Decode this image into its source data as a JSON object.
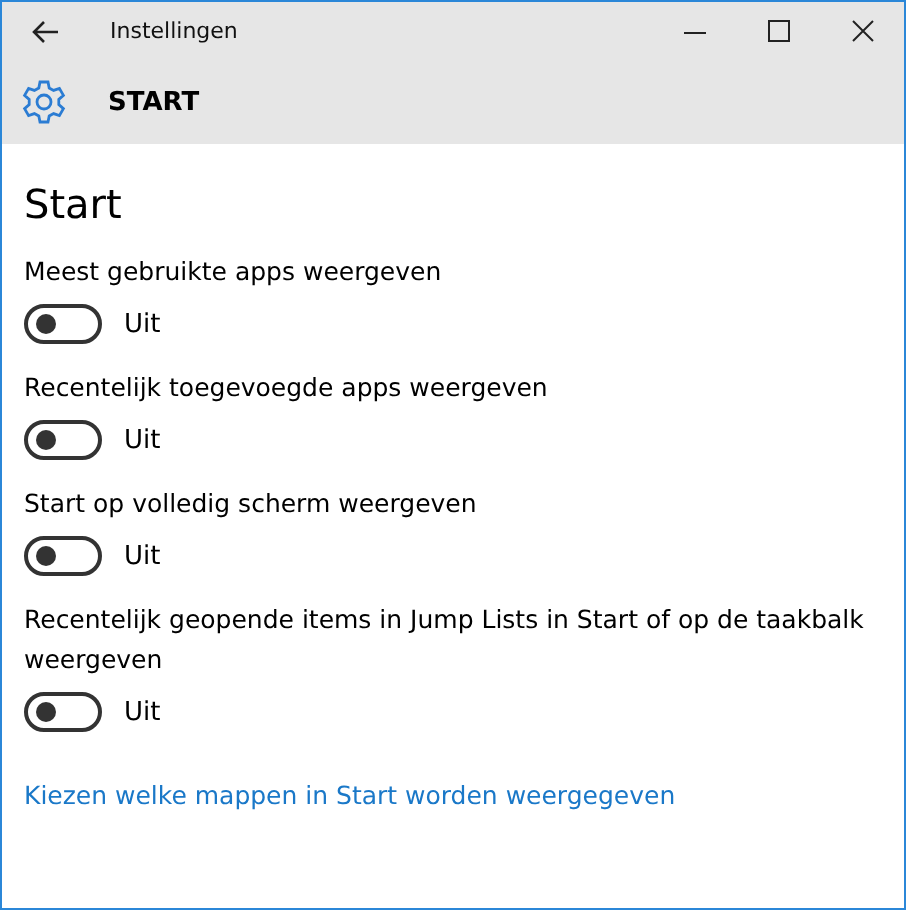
{
  "window": {
    "title": "Instellingen"
  },
  "header": {
    "title": "START"
  },
  "page": {
    "heading": "Start"
  },
  "settings": [
    {
      "label": "Meest gebruikte apps weergeven",
      "on": false,
      "state_text": "Uit"
    },
    {
      "label": "Recentelijk toegevoegde apps weergeven",
      "on": false,
      "state_text": "Uit"
    },
    {
      "label": "Start op volledig scherm weergeven",
      "on": false,
      "state_text": "Uit"
    },
    {
      "label": "Recentelijk geopende items in Jump Lists in Start of op de taakbalk weergeven",
      "on": false,
      "state_text": "Uit"
    }
  ],
  "link": "Kiezen welke mappen in Start worden weergegeven"
}
